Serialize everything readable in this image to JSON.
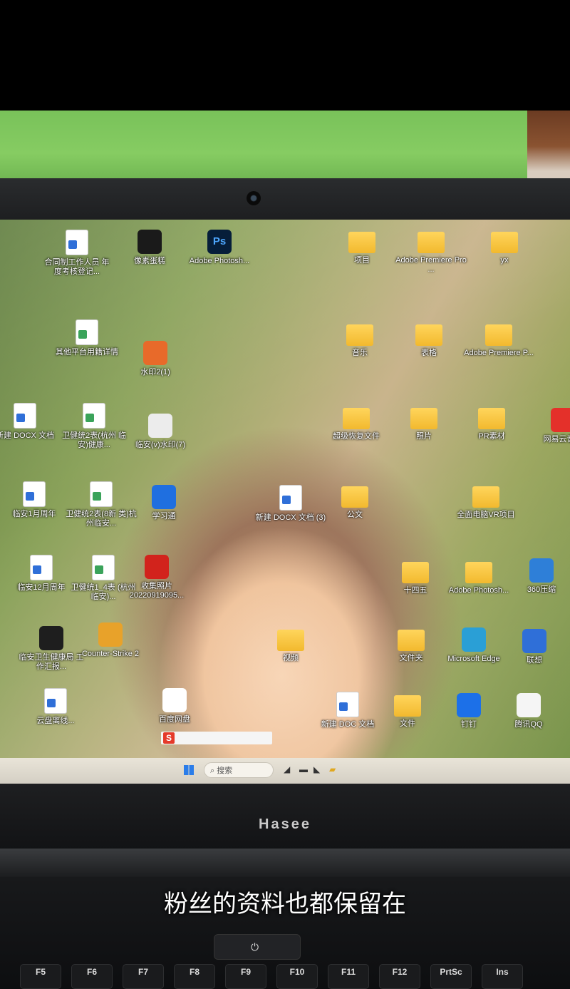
{
  "desktop_icons": [
    {
      "label": "合同制工作人员 年度考核登记...",
      "type": "doc-w"
    },
    {
      "label": "像素蛋糕",
      "type": "app",
      "color": "#1a1a1a"
    },
    {
      "label": "Adobe Photosh...",
      "type": "ps"
    },
    {
      "label": "项目",
      "type": "folder"
    },
    {
      "label": "Adobe Premiere Pro ...",
      "type": "folder"
    },
    {
      "label": "yx",
      "type": "folder"
    },
    {
      "label": "其他平台用籍详情",
      "type": "doc-s"
    },
    {
      "label": "水印2(1)",
      "type": "app",
      "color": "#e86a2a"
    },
    {
      "label": "音乐",
      "type": "folder"
    },
    {
      "label": "表格",
      "type": "folder"
    },
    {
      "label": "Adobe Premiere P...",
      "type": "folder"
    },
    {
      "label": "新建 DOCX 文档",
      "type": "doc-w"
    },
    {
      "label": "卫健统2表(杭州 临安)健康...",
      "type": "doc-s"
    },
    {
      "label": "临安(v)水印(7)",
      "type": "app",
      "color": "#ececec"
    },
    {
      "label": "超级恢复文件",
      "type": "folder"
    },
    {
      "label": "照片",
      "type": "folder"
    },
    {
      "label": "PR素材",
      "type": "folder"
    },
    {
      "label": "网易云音乐",
      "type": "app",
      "color": "#e4302a"
    },
    {
      "label": "临安1月周年",
      "type": "doc-w"
    },
    {
      "label": "卫健统2表(8新 类)杭州临安...",
      "type": "doc-s"
    },
    {
      "label": "学习通",
      "type": "app",
      "color": "#1f6fe0"
    },
    {
      "label": "新建 DOCX 文档 (3)",
      "type": "doc-w"
    },
    {
      "label": "公文",
      "type": "folder"
    },
    {
      "label": "全面电脑VR项目",
      "type": "folder"
    },
    {
      "label": "临安12月周年",
      "type": "doc-w"
    },
    {
      "label": "卫健统1_4表 (杭州临安)...",
      "type": "doc-s"
    },
    {
      "label": "收集照片 20220919095...",
      "type": "app",
      "color": "#d2231c"
    },
    {
      "label": "十四五",
      "type": "folder"
    },
    {
      "label": "Adobe Photosh...",
      "type": "folder"
    },
    {
      "label": "360压缩",
      "type": "app",
      "color": "#2e7fd8"
    },
    {
      "label": "临安卫生健康局 工作汇报...",
      "type": "app",
      "color": "#1e1e1e"
    },
    {
      "label": "Counter-Strike 2",
      "type": "app",
      "color": "#e8a22a"
    },
    {
      "label": "视频",
      "type": "folder"
    },
    {
      "label": "文件夹",
      "type": "folder"
    },
    {
      "label": "Microsoft Edge",
      "type": "app",
      "color": "#2a9fd6"
    },
    {
      "label": "联想",
      "type": "app",
      "color": "#2f6fd8"
    },
    {
      "label": "云盘离线...",
      "type": "doc-w"
    },
    {
      "label": "百度网盘",
      "type": "app",
      "color": "#ffffff"
    },
    {
      "label": "新建 DOC 文档",
      "type": "doc-w"
    },
    {
      "label": "文件",
      "type": "folder"
    },
    {
      "label": "钉钉",
      "type": "app",
      "color": "#1c70e8"
    },
    {
      "label": "腾讯QQ",
      "type": "app",
      "color": "#f5f5f5"
    }
  ],
  "taskbar": {
    "search_label": "搜索"
  },
  "ime": {
    "logo": "S"
  },
  "brand": "Hasee",
  "subtitle": "粉丝的资料也都保留在",
  "fkeys": [
    "F5",
    "F6",
    "F7",
    "F8",
    "F9",
    "F10",
    "F11",
    "F12",
    "PrtSc",
    "Ins"
  ],
  "power_glyph": "⏻"
}
